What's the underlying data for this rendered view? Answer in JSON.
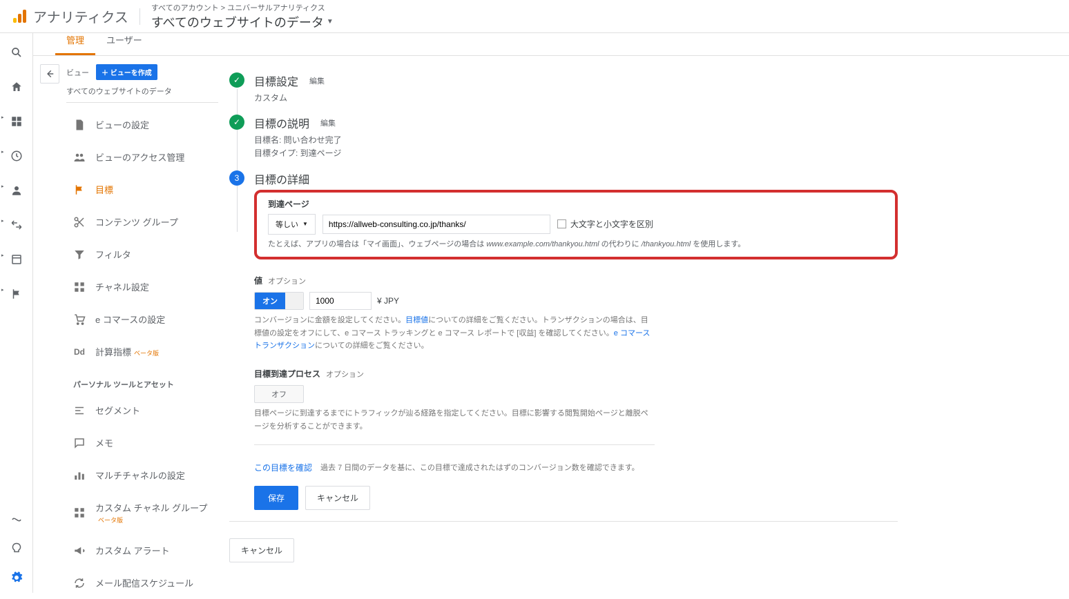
{
  "header": {
    "product": "アナリティクス",
    "crumb": "すべてのアカウント > ユニバーサルアナリティクス",
    "view_name": "すべてのウェブサイトのデータ"
  },
  "tabs": {
    "admin": "管理",
    "user": "ユーザー"
  },
  "view_panel": {
    "label": "ビュー",
    "create_btn": "＋ ビューを作成",
    "current": "すべてのウェブサイトのデータ",
    "items": [
      "ビューの設定",
      "ビューのアクセス管理",
      "目標",
      "コンテンツ グループ",
      "フィルタ",
      "チャネル設定",
      "e コマースの設定",
      "計算指標"
    ],
    "beta": "ベータ版",
    "section": "パーソナル ツールとアセット",
    "personal": [
      "セグメント",
      "メモ",
      "マルチチャネルの設定",
      "カスタム チャネル グループ",
      "カスタム アラート",
      "メール配信スケジュール"
    ]
  },
  "steps": {
    "s1": {
      "title": "目標設定",
      "edit": "編集",
      "info": "カスタム"
    },
    "s2": {
      "title": "目標の説明",
      "edit": "編集",
      "name_line": "目標名: 問い合わせ完了",
      "type_line": "目標タイプ: 到達ページ"
    },
    "s3": {
      "num": "3",
      "title": "目標の詳細"
    }
  },
  "dest": {
    "label": "到達ページ",
    "match": "等しい",
    "url": "https://allweb-consulting.co.jp/thanks/",
    "case_label": "大文字と小文字を区別",
    "hint_pre": "たとえば、アプリの場合は「マイ画面」、ウェブページの場合は ",
    "hint_ex1": "www.example.com/thankyou.html",
    "hint_mid": " の代わりに ",
    "hint_ex2": "/thankyou.html",
    "hint_post": " を使用します。"
  },
  "value": {
    "label": "値",
    "opt": "オプション",
    "on": "オン",
    "amount": "1000",
    "currency": "¥ JPY",
    "desc1": "コンバージョンに金額を設定してください。",
    "link1": "目標値",
    "desc2": "についての詳細をご覧ください。トランザクションの場合は、目標値の設定をオフにして、e コマース トラッキングと e コマース レポートで [収益] を確認してください。",
    "link2": "e コマース トランザクション",
    "desc3": "についての詳細をご覧ください。"
  },
  "funnel": {
    "label": "目標到達プロセス",
    "opt": "オプション",
    "off": "オフ",
    "desc": "目標ページに到達するまでにトラフィックが辿る経路を指定してください。目標に影響する閲覧開始ページと離脱ページを分析することができます。"
  },
  "verify": {
    "link": "この目標を確認",
    "text": "過去 7 日間のデータを基に、この目標で達成されたはずのコンバージョン数を確認できます。"
  },
  "buttons": {
    "save": "保存",
    "cancel": "キャンセル",
    "outer_cancel": "キャンセル"
  }
}
